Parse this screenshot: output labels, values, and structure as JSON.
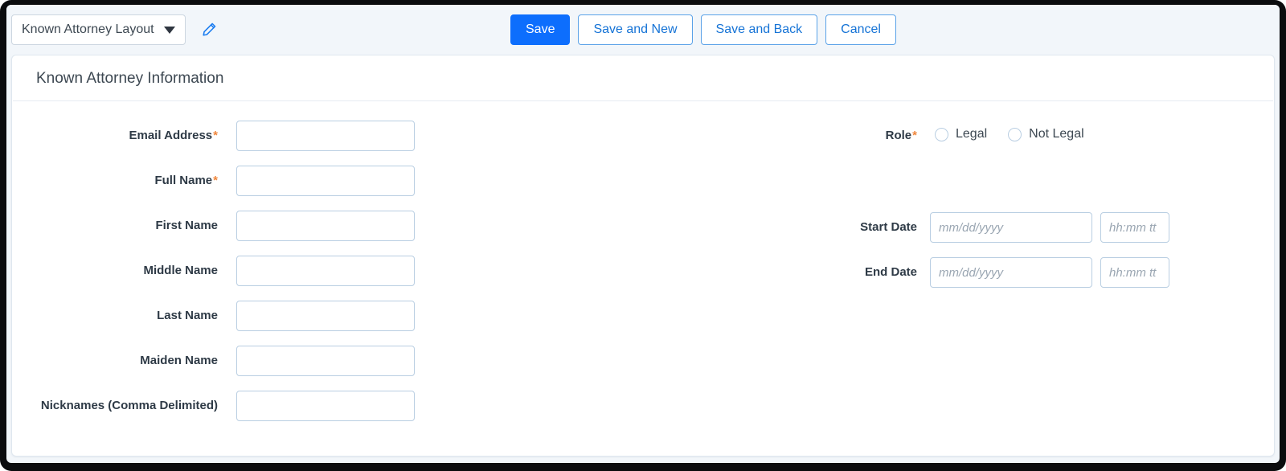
{
  "toolbar": {
    "layout_select": {
      "value": "Known Attorney Layout",
      "caret_icon": "chevron-down-icon"
    },
    "edit_icon": "pencil-icon",
    "buttons": [
      {
        "label": "Save",
        "style": "primary"
      },
      {
        "label": "Save and New",
        "style": "outline"
      },
      {
        "label": "Save and Back",
        "style": "outline"
      },
      {
        "label": "Cancel",
        "style": "outline"
      }
    ]
  },
  "section": {
    "title": "Known Attorney Information"
  },
  "left_fields": [
    {
      "label": "Email Address",
      "required": true,
      "value": "",
      "placeholder": ""
    },
    {
      "label": "Full Name",
      "required": true,
      "value": "",
      "placeholder": ""
    },
    {
      "label": "First Name",
      "required": false,
      "value": "",
      "placeholder": ""
    },
    {
      "label": "Middle Name",
      "required": false,
      "value": "",
      "placeholder": ""
    },
    {
      "label": "Last Name",
      "required": false,
      "value": "",
      "placeholder": ""
    },
    {
      "label": "Maiden Name",
      "required": false,
      "value": "",
      "placeholder": ""
    },
    {
      "label": "Nicknames (Comma Delimited)",
      "required": false,
      "value": "",
      "placeholder": ""
    }
  ],
  "right_fields": {
    "role": {
      "label": "Role",
      "required": true,
      "options": [
        {
          "label": "Legal",
          "selected": false
        },
        {
          "label": "Not Legal",
          "selected": false
        }
      ]
    },
    "start_date": {
      "label": "Start Date",
      "date_value": "",
      "date_placeholder": "mm/dd/yyyy",
      "time_value": "",
      "time_placeholder": "hh:mm tt"
    },
    "end_date": {
      "label": "End Date",
      "date_value": "",
      "date_placeholder": "mm/dd/yyyy",
      "time_value": "",
      "time_placeholder": "hh:mm tt"
    }
  },
  "colors": {
    "primary": "#0d6efd",
    "link": "#1573d6",
    "required_star": "#f0873c",
    "toolbar_bg": "#f2f6fa",
    "input_border": "#b9cee2",
    "label_text": "#2e3a46"
  }
}
